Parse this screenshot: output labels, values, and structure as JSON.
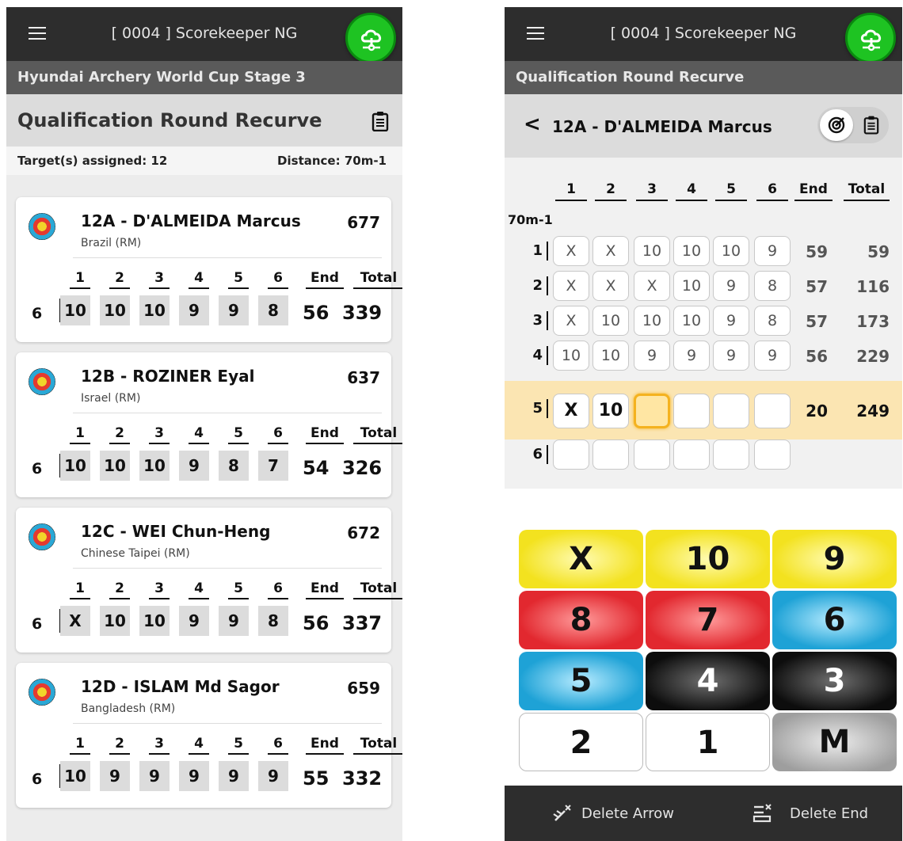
{
  "app": {
    "title": "[ 0004 ] Scorekeeper NG"
  },
  "left": {
    "event": "Hyundai Archery World Cup Stage 3",
    "round": "Qualification Round Recurve",
    "targets_assigned": "Target(s) assigned: 12",
    "distance": "Distance: 70m-1",
    "columns": [
      "1",
      "2",
      "3",
      "4",
      "5",
      "6",
      "End",
      "Total"
    ],
    "athletes": [
      {
        "name": "12A - D'ALMEIDA Marcus",
        "country": "Brazil (RM)",
        "score": "677",
        "row": "6",
        "arrows": [
          "10",
          "10",
          "10",
          "9",
          "9",
          "8"
        ],
        "end": "56",
        "total": "339"
      },
      {
        "name": "12B - ROZINER Eyal",
        "country": "Israel (RM)",
        "score": "637",
        "row": "6",
        "arrows": [
          "10",
          "10",
          "10",
          "9",
          "8",
          "7"
        ],
        "end": "54",
        "total": "326"
      },
      {
        "name": "12C - WEI Chun-Heng",
        "country": "Chinese Taipei (RM)",
        "score": "672",
        "row": "6",
        "arrows": [
          "X",
          "10",
          "10",
          "9",
          "9",
          "8"
        ],
        "end": "56",
        "total": "337"
      },
      {
        "name": "12D - ISLAM Md Sagor",
        "country": "Bangladesh (RM)",
        "score": "659",
        "row": "6",
        "arrows": [
          "10",
          "9",
          "9",
          "9",
          "9",
          "9"
        ],
        "end": "55",
        "total": "332"
      }
    ]
  },
  "right": {
    "event": "Qualification Round Recurve",
    "athlete": "12A - D'ALMEIDA Marcus",
    "back_glyph": "<",
    "columns": [
      "1",
      "2",
      "3",
      "4",
      "5",
      "6",
      "End",
      "Total"
    ],
    "distance_label": "70m-1",
    "ends": [
      {
        "n": "1",
        "arrows": [
          "X",
          "X",
          "10",
          "10",
          "10",
          "9"
        ],
        "end": "59",
        "total": "59"
      },
      {
        "n": "2",
        "arrows": [
          "X",
          "X",
          "X",
          "10",
          "9",
          "8"
        ],
        "end": "57",
        "total": "116"
      },
      {
        "n": "3",
        "arrows": [
          "X",
          "10",
          "10",
          "10",
          "9",
          "8"
        ],
        "end": "57",
        "total": "173"
      },
      {
        "n": "4",
        "arrows": [
          "10",
          "10",
          "9",
          "9",
          "9",
          "9"
        ],
        "end": "56",
        "total": "229"
      },
      {
        "n": "5",
        "arrows": [
          "X",
          "10",
          "",
          "",
          "",
          ""
        ],
        "end": "20",
        "total": "249"
      },
      {
        "n": "6",
        "arrows": [
          "",
          "",
          "",
          "",
          "",
          ""
        ],
        "end": "",
        "total": ""
      }
    ],
    "keys": [
      "X",
      "10",
      "9",
      "8",
      "7",
      "6",
      "5",
      "4",
      "3",
      "2",
      "1",
      "M"
    ],
    "delete_arrow": "Delete Arrow",
    "delete_end": "Delete End"
  },
  "colors": {
    "appbar": "#2d2d2d",
    "cloud": "#1ec322",
    "active_row": "#fbe5b2",
    "active_cell": "#f4b21f"
  },
  "icons": [
    "menu-icon",
    "cloud-sync-icon",
    "clipboard-icon",
    "target-icon",
    "back-icon",
    "target-toggle-icon",
    "delete-arrow-icon",
    "delete-end-icon"
  ]
}
